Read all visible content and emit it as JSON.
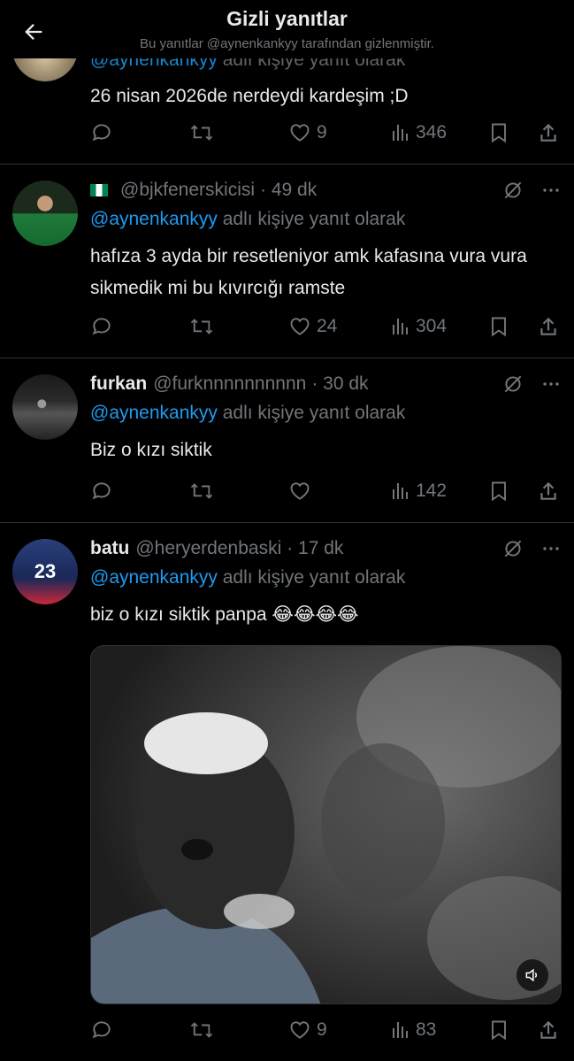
{
  "header": {
    "title": "Gizli yanıtlar",
    "subtitle": "Bu yanıtlar @aynenkankyy tarafından gizlenmiştir."
  },
  "reply_prefix": "@aynenkankyy",
  "reply_suffix": " adlı kişiye yanıt olarak",
  "tweets": [
    {
      "text": "26 nisan 2026de nerdeydi kardeşim ;D",
      "likes": "9",
      "views": "346"
    },
    {
      "handle": "@bjkfenerskicisi",
      "time": "· 49 dk",
      "text": "hafıza 3 ayda bir resetleniyor amk kafasına vura vura sikmedik mi bu kıvırcığı ramste",
      "likes": "24",
      "views": "304"
    },
    {
      "name": "furkan",
      "handle": "@furknnnnnnnnnn",
      "time": "· 30 dk",
      "text": "Biz o kızı siktik",
      "likes": "",
      "views": "142"
    },
    {
      "name": "batu",
      "handle": "@heryerdenbaski",
      "time": "· 17 dk",
      "text": "biz o kızı siktik panpa 😂😂😂😂",
      "likes": "9",
      "views": "83",
      "avatar_number": "23"
    }
  ],
  "colors": {
    "background": "#000000",
    "text": "#e7e9ea",
    "muted": "#71767b",
    "link": "#1d9bf0",
    "divider": "#2f3336"
  }
}
